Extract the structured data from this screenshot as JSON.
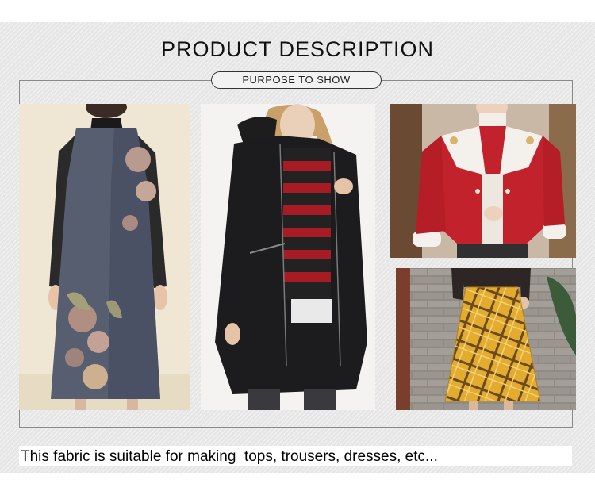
{
  "header": {
    "title": "PRODUCT DESCRIPTION",
    "subtitle": "PURPOSE TO SHOW"
  },
  "gallery": [
    {
      "id": "dress",
      "subject": "sleeveless-embroidered-dress"
    },
    {
      "id": "coat",
      "subject": "black-parka-coat"
    },
    {
      "id": "jacket",
      "subject": "red-fleece-jacket"
    },
    {
      "id": "skirt",
      "subject": "yellow-plaid-skirt"
    }
  ],
  "footer": {
    "caption": "This fabric is suitable for making  tops, trousers, dresses, etc..."
  },
  "colors": {
    "banner_bg": "#e6e6e6",
    "frame_line": "#8a8a8a",
    "text": "#111111"
  }
}
